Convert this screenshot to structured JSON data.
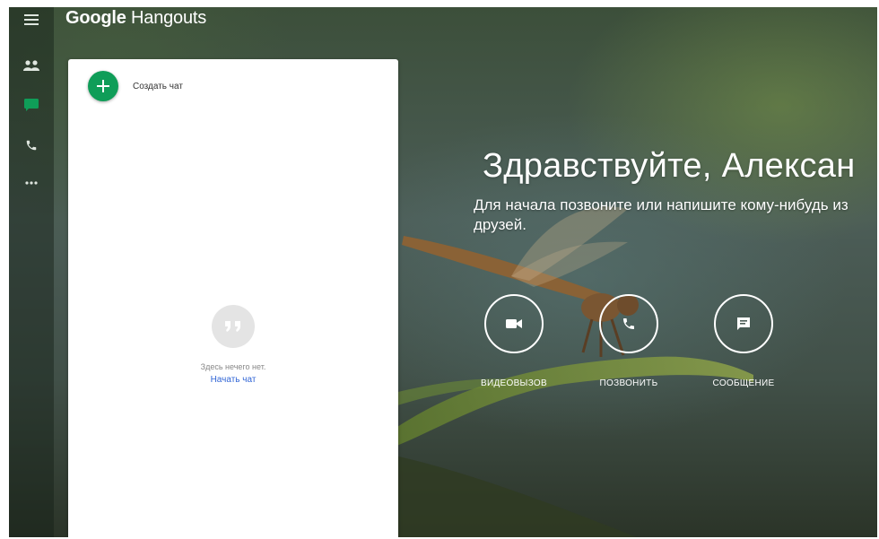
{
  "header": {
    "brand": "Google",
    "product": "Hangouts"
  },
  "rail": {
    "items": [
      {
        "icon": "menu-icon"
      },
      {
        "icon": "contacts-icon"
      },
      {
        "icon": "chat-icon"
      },
      {
        "icon": "phone-icon"
      },
      {
        "icon": "more-icon"
      }
    ]
  },
  "panel": {
    "new_chat_label": "Создать чат",
    "empty_hint": "Здесь нечего нет.",
    "start_chat_link": "Начать чат"
  },
  "main": {
    "greeting": "Здравствуйте, Алексан",
    "subtitle": "Для начала позвоните или напишите кому-нибудь из друзей.",
    "actions": [
      {
        "label": "ВИДЕОВЫЗОВ",
        "icon": "video-icon"
      },
      {
        "label": "ПОЗВОНИТЬ",
        "icon": "phone-icon"
      },
      {
        "label": "СООБЩЕНИЕ",
        "icon": "message-icon"
      }
    ]
  },
  "colors": {
    "accent_green": "#0f9d58",
    "link_blue": "#3367d6",
    "active_rail": "#0f9d58"
  }
}
